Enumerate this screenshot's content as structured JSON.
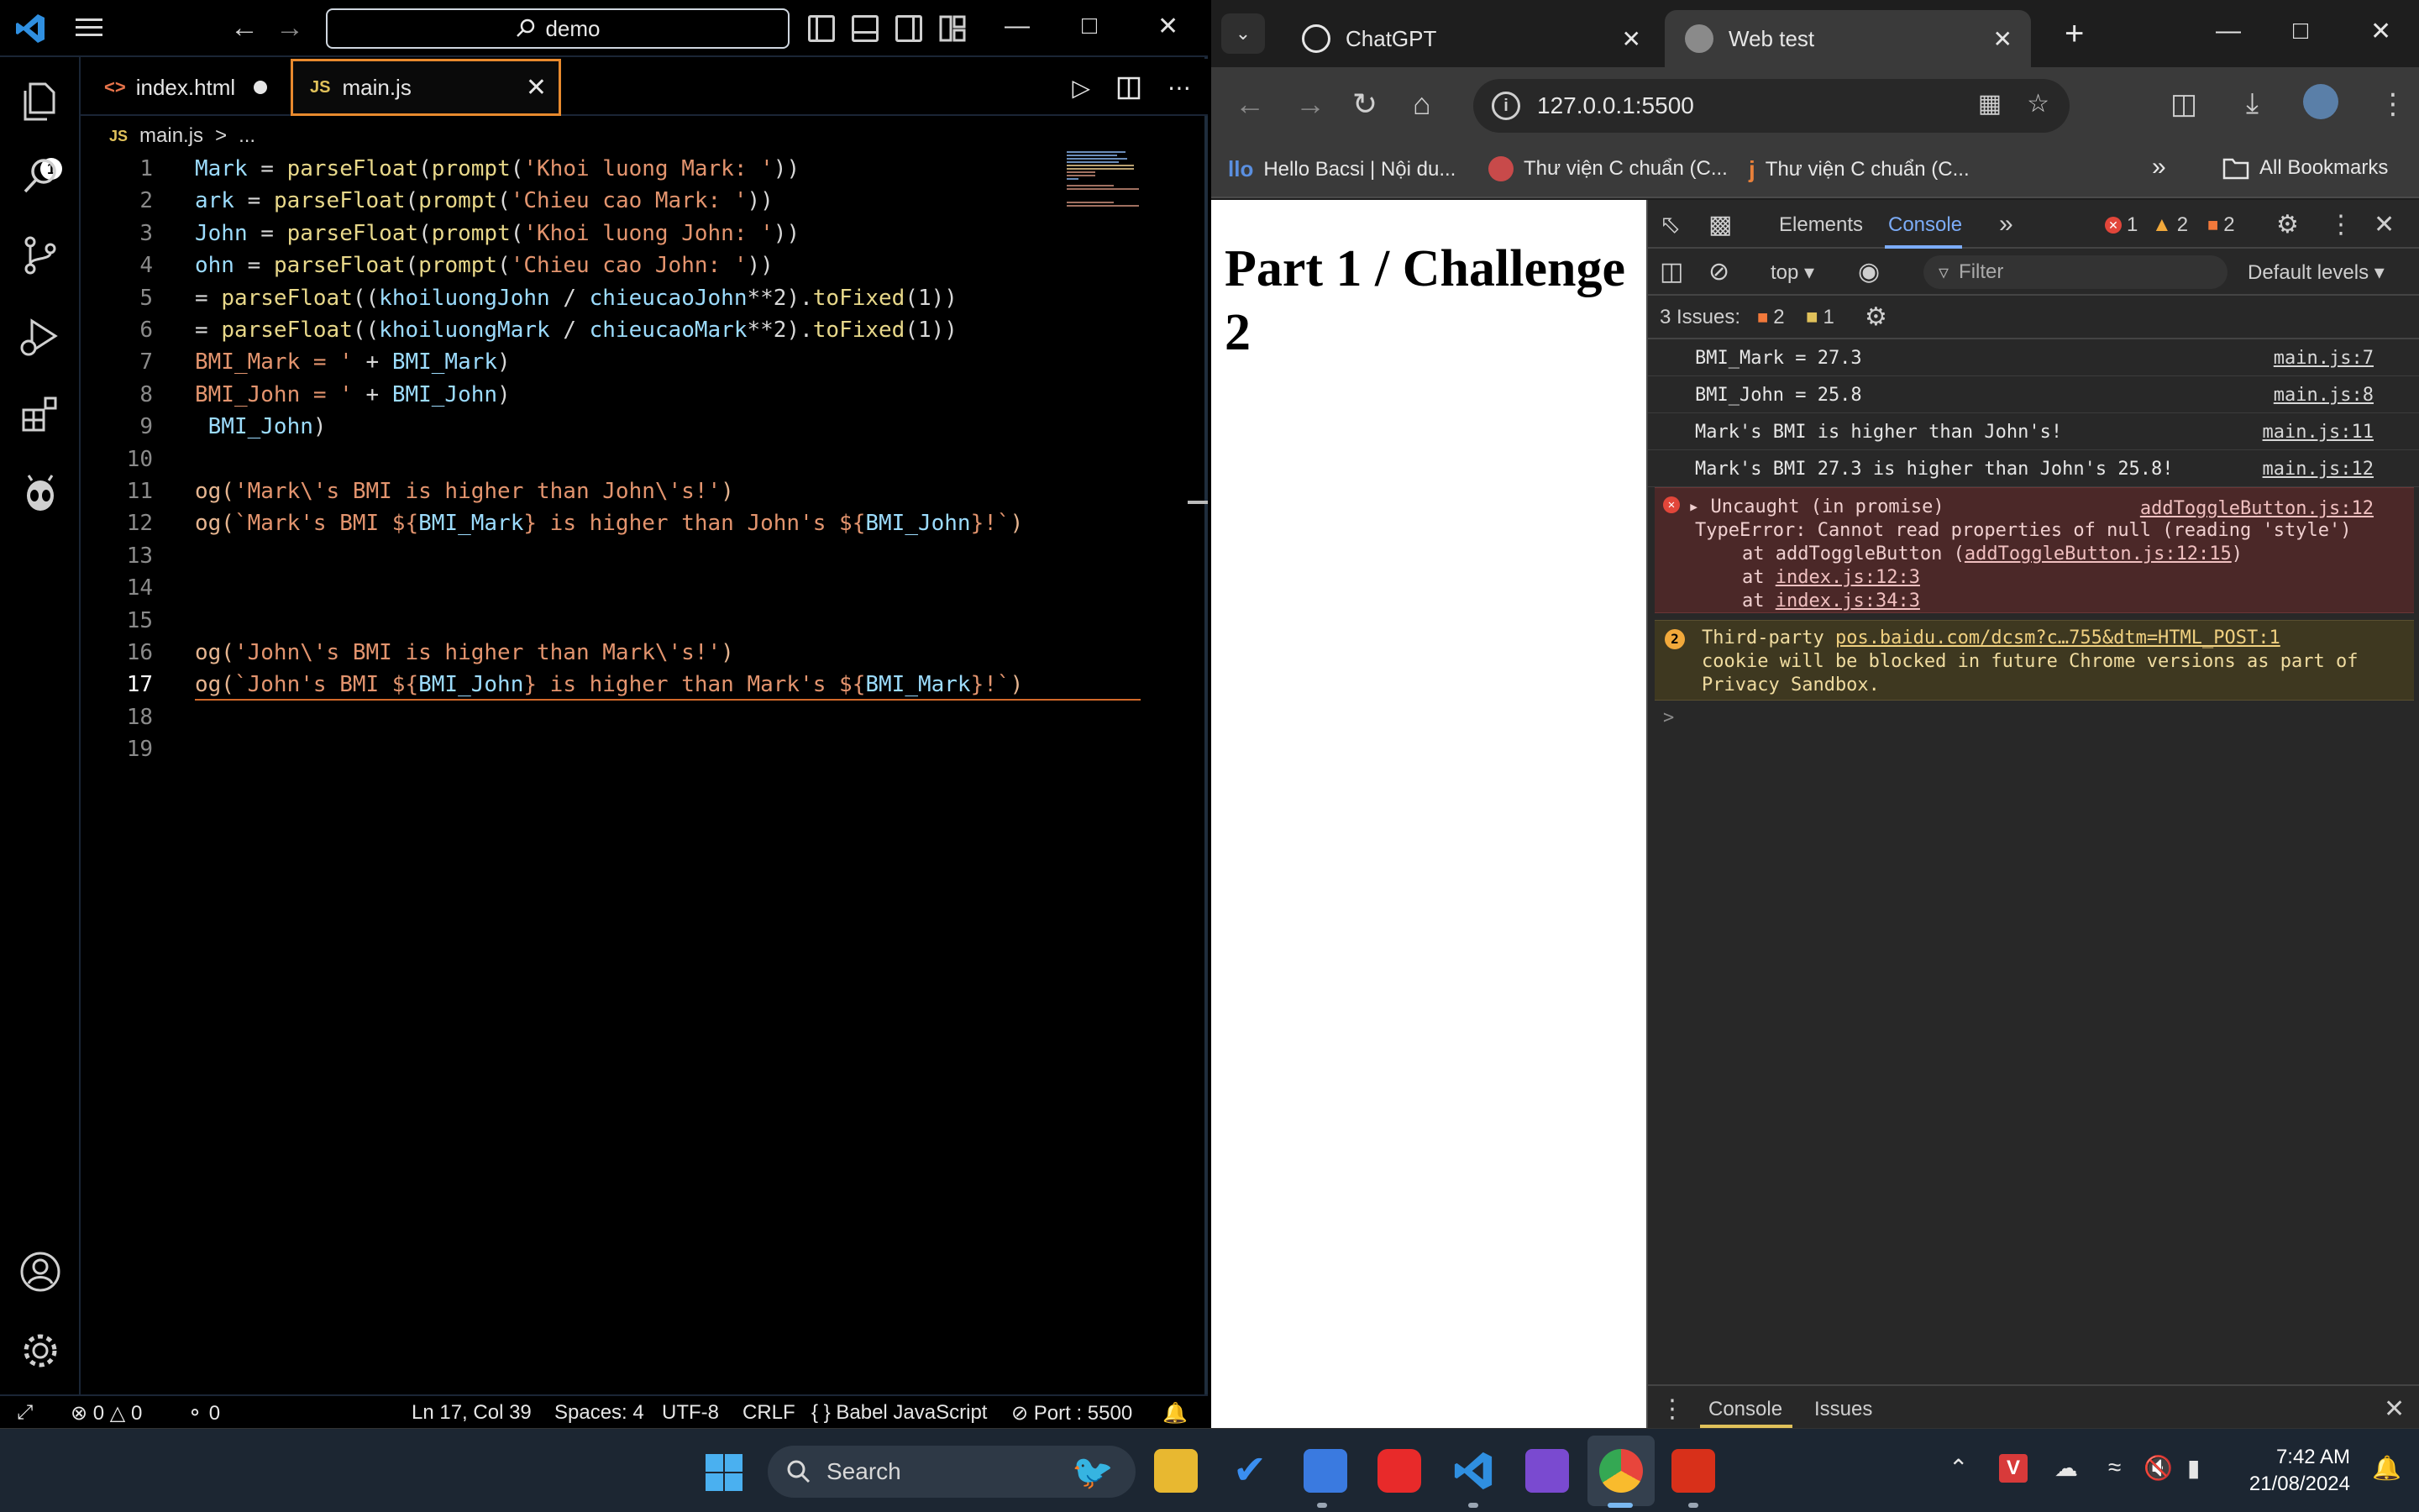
{
  "vscode": {
    "search_text": "demo",
    "tabs": [
      {
        "label": "index.html",
        "icon": "<>"
      },
      {
        "label": "main.js",
        "icon": "JS"
      }
    ],
    "breadcrumb": {
      "icon": "JS",
      "file": "main.js",
      "sep": ">",
      "rest": "..."
    },
    "code_lines": [
      {
        "n": "1",
        "parts": [
          [
            "c-var",
            "Mark"
          ],
          [
            "c-op",
            " = "
          ],
          [
            "c-fn",
            "parseFloat"
          ],
          [
            "c-op",
            "("
          ],
          [
            "c-fn",
            "prompt"
          ],
          [
            "c-op",
            "("
          ],
          [
            "c-str",
            "'Khoi luong Mark: '"
          ],
          [
            "c-op",
            "))"
          ]
        ]
      },
      {
        "n": "2",
        "parts": [
          [
            "c-var",
            "ark"
          ],
          [
            "c-op",
            " = "
          ],
          [
            "c-fn",
            "parseFloat"
          ],
          [
            "c-op",
            "("
          ],
          [
            "c-fn",
            "prompt"
          ],
          [
            "c-op",
            "("
          ],
          [
            "c-str",
            "'Chieu cao Mark: '"
          ],
          [
            "c-op",
            "))"
          ]
        ]
      },
      {
        "n": "3",
        "parts": [
          [
            "c-var",
            "John"
          ],
          [
            "c-op",
            " = "
          ],
          [
            "c-fn",
            "parseFloat"
          ],
          [
            "c-op",
            "("
          ],
          [
            "c-fn",
            "prompt"
          ],
          [
            "c-op",
            "("
          ],
          [
            "c-str",
            "'Khoi luong John: '"
          ],
          [
            "c-op",
            "))"
          ]
        ]
      },
      {
        "n": "4",
        "parts": [
          [
            "c-var",
            "ohn"
          ],
          [
            "c-op",
            " = "
          ],
          [
            "c-fn",
            "parseFloat"
          ],
          [
            "c-op",
            "("
          ],
          [
            "c-fn",
            "prompt"
          ],
          [
            "c-op",
            "("
          ],
          [
            "c-str",
            "'Chieu cao John: '"
          ],
          [
            "c-op",
            "))"
          ]
        ]
      },
      {
        "n": "5",
        "parts": [
          [
            "c-op",
            "= "
          ],
          [
            "c-fn",
            "parseFloat"
          ],
          [
            "c-op",
            "(("
          ],
          [
            "c-var",
            "khoiluongJohn"
          ],
          [
            "c-op",
            " / "
          ],
          [
            "c-var",
            "chieucaoJohn"
          ],
          [
            "c-op",
            "**2)."
          ],
          [
            "c-fn",
            "toFixed"
          ],
          [
            "c-op",
            "(1))"
          ]
        ]
      },
      {
        "n": "6",
        "parts": [
          [
            "c-op",
            "= "
          ],
          [
            "c-fn",
            "parseFloat"
          ],
          [
            "c-op",
            "(("
          ],
          [
            "c-var",
            "khoiluongMark"
          ],
          [
            "c-op",
            " / "
          ],
          [
            "c-var",
            "chieucaoMark"
          ],
          [
            "c-op",
            "**2)."
          ],
          [
            "c-fn",
            "toFixed"
          ],
          [
            "c-op",
            "(1))"
          ]
        ]
      },
      {
        "n": "7",
        "parts": [
          [
            "c-str",
            "BMI_Mark = '"
          ],
          [
            "c-op",
            " + "
          ],
          [
            "c-var",
            "BMI_Mark"
          ],
          [
            "c-op",
            ")"
          ]
        ]
      },
      {
        "n": "8",
        "parts": [
          [
            "c-str",
            "BMI_John = '"
          ],
          [
            "c-op",
            " + "
          ],
          [
            "c-var",
            "BMI_John"
          ],
          [
            "c-op",
            ")"
          ]
        ]
      },
      {
        "n": "9",
        "parts": [
          [
            "c-var",
            " BMI_John"
          ],
          [
            "c-op",
            ")"
          ]
        ]
      },
      {
        "n": "10",
        "parts": []
      },
      {
        "n": "11",
        "parts": [
          [
            "c-plain",
            "og("
          ],
          [
            "c-str",
            "'Mark\\'s BMI is higher than John\\'s!'"
          ],
          [
            "c-plain",
            ")"
          ]
        ]
      },
      {
        "n": "12",
        "parts": [
          [
            "c-plain",
            "og("
          ],
          [
            "c-str",
            "`Mark's BMI ${"
          ],
          [
            "c-var",
            "BMI_Mark"
          ],
          [
            "c-str",
            "} is higher than John's ${"
          ],
          [
            "c-var",
            "BMI_John"
          ],
          [
            "c-str",
            "}!`"
          ],
          [
            "c-plain",
            ")"
          ]
        ]
      },
      {
        "n": "13",
        "parts": []
      },
      {
        "n": "14",
        "parts": []
      },
      {
        "n": "15",
        "parts": []
      },
      {
        "n": "16",
        "parts": [
          [
            "c-plain",
            "og("
          ],
          [
            "c-str",
            "'John\\'s BMI is higher than Mark\\'s!'"
          ],
          [
            "c-plain",
            ")"
          ]
        ]
      },
      {
        "n": "17",
        "parts": [
          [
            "c-plain",
            "og("
          ],
          [
            "c-str",
            "`John's BMI ${"
          ],
          [
            "c-var",
            "BMI_John"
          ],
          [
            "c-str",
            "} is higher than Mark's ${"
          ],
          [
            "c-var",
            "BMI_Mark"
          ],
          [
            "c-str",
            "}!`"
          ],
          [
            "c-plain",
            ")"
          ]
        ]
      },
      {
        "n": "18",
        "parts": []
      },
      {
        "n": "19",
        "parts": []
      }
    ],
    "active_line": "17",
    "status": {
      "errors": "0",
      "warnings": "0",
      "ports": "0",
      "position": "Ln 17, Col 39",
      "spaces": "Spaces: 4",
      "encoding": "UTF-8",
      "eol": "CRLF",
      "language": "Babel JavaScript",
      "port": "Port : 5500"
    },
    "explorer_badge": "1"
  },
  "chrome": {
    "tabs": [
      {
        "title": "ChatGPT"
      },
      {
        "title": "Web test"
      }
    ],
    "url": "127.0.0.1:5500",
    "bookmarks": [
      {
        "label": "Hello Bacsi | Nội du..."
      },
      {
        "label": "Thư viện C chuẩn (C..."
      },
      {
        "label": "Thư viện C chuẩn (C..."
      }
    ],
    "all_bookmarks": "All Bookmarks",
    "page_heading": "Part 1 / Challenge 2",
    "devtools": {
      "tab_elements": "Elements",
      "tab_console": "Console",
      "error_count": "1",
      "warning_count": "2",
      "issue_count": "2",
      "context": "top",
      "filter_placeholder": "Filter",
      "levels": "Default levels",
      "issues_label": "3 Issues:",
      "issues_warn": "2",
      "issues_info": "1",
      "logs": [
        {
          "msg": "BMI_Mark = 27.3",
          "src": "main.js:7"
        },
        {
          "msg": "BMI_John = 25.8",
          "src": "main.js:8"
        },
        {
          "msg": "Mark's BMI is higher than John's!",
          "src": "main.js:11"
        },
        {
          "msg": "Mark's BMI 27.3 is higher than John's 25.8!",
          "src": "main.js:12"
        }
      ],
      "error": {
        "title": "Uncaught (in promise)",
        "src": "addToggleButton.js:12",
        "message": "TypeError: Cannot read properties of null (reading 'style')",
        "at1_pre": "at addToggleButton (",
        "at1_link": "addToggleButton.js:12:15",
        "at1_post": ")",
        "at2_pre": "at ",
        "at2_link": "index.js:12:3",
        "at3_pre": "at ",
        "at3_link": "index.js:34:3"
      },
      "warning": {
        "count": "2",
        "pre": "Third-party ",
        "link": "pos.baidu.com/dcsm?c…755&dtm=HTML_POST:1",
        "line2": "cookie will be blocked in future Chrome versions as part of",
        "line3": "Privacy Sandbox."
      },
      "drawer_console": "Console",
      "drawer_issues": "Issues"
    }
  },
  "taskbar": {
    "search_label": "Search",
    "time": "7:42 AM",
    "date": "21/08/2024"
  },
  "colors": {
    "accent_orange": "#e88a2e",
    "devtools_blue": "#7cacf8",
    "error_red": "#e2463a",
    "warning_amber": "#f2a93b"
  }
}
